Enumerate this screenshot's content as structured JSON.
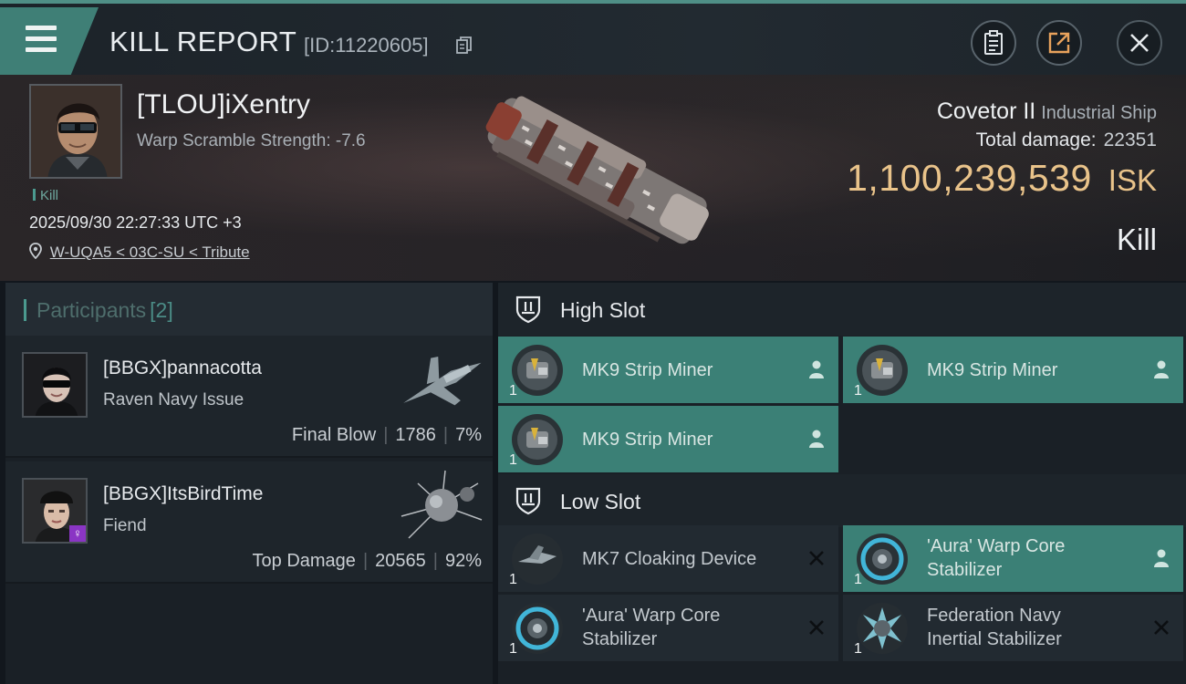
{
  "header": {
    "title": "KILL REPORT",
    "kill_id": "[ID:11220605]"
  },
  "victim": {
    "name": "[TLOU]iXentry",
    "warp_scramble": "Warp Scramble Strength: -7.6",
    "badge": "Kill",
    "timestamp": "2025/09/30 22:27:33 UTC +3",
    "location": "W-UQA5 < 03C-SU < Tribute",
    "ship_name": "Covetor II",
    "ship_class": "Industrial Ship",
    "total_damage_label": "Total damage:",
    "total_damage": "22351",
    "isk_value": "1,100,239,539",
    "isk_unit": "ISK",
    "kill_type": "Kill"
  },
  "participants": {
    "title": "Participants",
    "count": "[2]",
    "items": [
      {
        "name": "[BBGX]pannacotta",
        "ship": "Raven Navy Issue",
        "label": "Final Blow",
        "damage": "1786",
        "percent": "7%"
      },
      {
        "name": "[BBGX]ItsBirdTime",
        "ship": "Fiend",
        "label": "Top Damage",
        "damage": "20565",
        "percent": "92%",
        "tag": "♀"
      }
    ]
  },
  "fitting": {
    "high_slot": {
      "title": "High Slot",
      "modules": [
        {
          "name": "MK9 Strip Miner",
          "qty": "1",
          "status": "dropped"
        },
        {
          "name": "MK9 Strip Miner",
          "qty": "1",
          "status": "dropped"
        },
        {
          "name": "MK9 Strip Miner",
          "qty": "1",
          "status": "dropped"
        }
      ]
    },
    "low_slot": {
      "title": "Low Slot",
      "modules": [
        {
          "name": "MK7 Cloaking Device",
          "qty": "1",
          "status": "destroyed"
        },
        {
          "name_line1": "'Aura' Warp Core",
          "name_line2": "Stabilizer",
          "qty": "1",
          "status": "dropped"
        },
        {
          "name_line1": "'Aura' Warp Core",
          "name_line2": "Stabilizer",
          "qty": "1",
          "status": "destroyed"
        },
        {
          "name_line1": "Federation Navy",
          "name_line2": "Inertial Stabilizer",
          "qty": "1",
          "status": "destroyed"
        }
      ]
    }
  },
  "colors": {
    "accent_teal": "#3b8076",
    "isk_gold": "#e9c38a"
  },
  "icons": {
    "menu": "menu-icon",
    "copy": "copy-icon",
    "clipboard": "clipboard-icon",
    "share": "share-icon",
    "close": "close-icon",
    "location": "location-pin-icon",
    "slot": "slot-shield-icon",
    "dropped": "person-icon",
    "destroyed": "x-icon"
  }
}
